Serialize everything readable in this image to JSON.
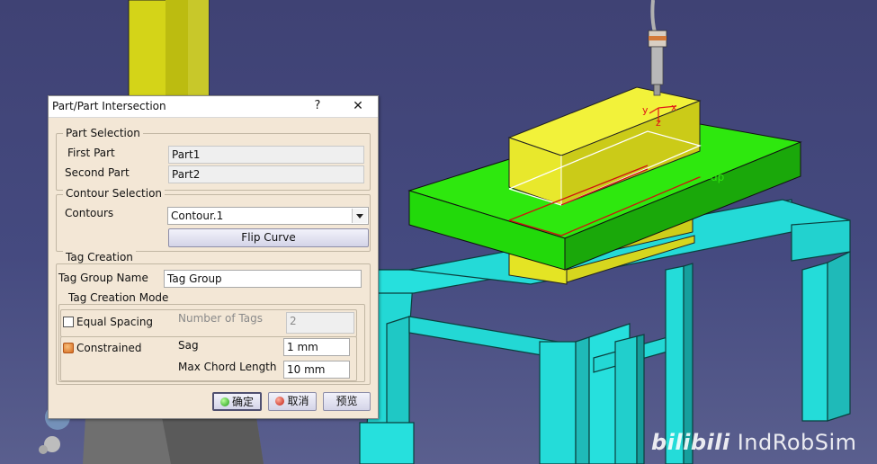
{
  "dialog": {
    "title": "Part/Part Intersection",
    "help": "?",
    "close": "✕",
    "part_selection": {
      "title": "Part Selection",
      "first_part_label": "First Part",
      "first_part_value": "Part1",
      "second_part_label": "Second Part",
      "second_part_value": "Part2"
    },
    "contour_selection": {
      "title": "Contour Selection",
      "contours_label": "Contours",
      "contours_value": "Contour.1",
      "flip_curve": "Flip Curve"
    },
    "tag_creation": {
      "title": "Tag Creation",
      "tag_group_name_label": "Tag Group Name",
      "tag_group_name_value": "Tag Group",
      "mode_title": "Tag Creation Mode",
      "equal_spacing_label": "Equal Spacing",
      "equal_spacing_checked": false,
      "number_of_tags_label": "Number of Tags",
      "number_of_tags_value": "2",
      "constrained_label": "Constrained",
      "constrained_checked": true,
      "sag_label": "Sag",
      "sag_value": "1 mm",
      "max_chord_label": "Max Chord Length",
      "max_chord_value": "10 mm"
    },
    "buttons": {
      "ok": "确定",
      "cancel": "取消",
      "preview": "预览"
    }
  },
  "viewport": {
    "axis_y": "y",
    "axis_x": "x",
    "axis_z": "z",
    "tag_label": "dp",
    "colors": {
      "background": "#434678",
      "table": "#26e0dd",
      "plate": "#22e000",
      "block": "#eeee2a",
      "pillar": "#d7d71c"
    }
  },
  "watermark": {
    "logo": "bilibili",
    "text": "IndRobSim"
  }
}
